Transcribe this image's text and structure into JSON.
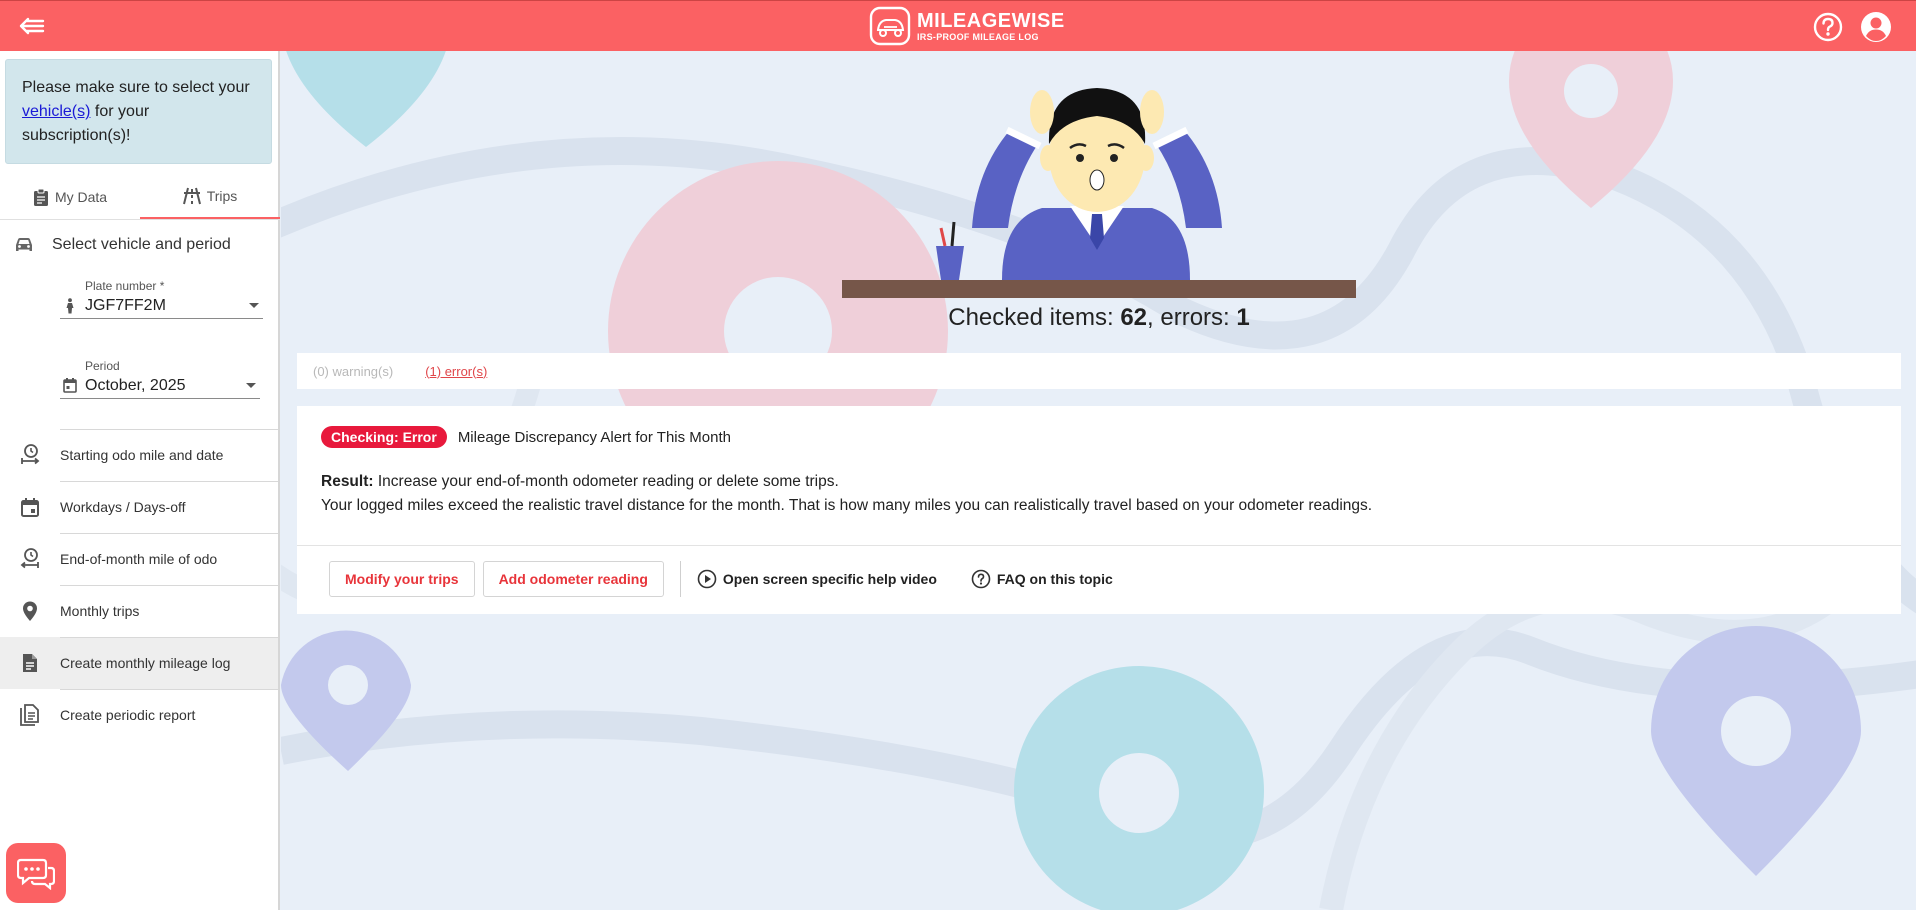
{
  "header": {
    "logo_title": "MILEAGEWISE",
    "logo_subtitle": "IRS-PROOF MILEAGE LOG",
    "back_icon": "arrow-back-icon",
    "help_icon": "help-icon",
    "account_icon": "account-icon",
    "accent_color": "#fb6163"
  },
  "sidebar": {
    "notice": {
      "prefix": "Please make sure to select your",
      "link": "vehicle(s)",
      "suffix": "for your subscription(s)!"
    },
    "tabs": [
      {
        "label": "My Data",
        "icon": "clipboard-icon",
        "active": false
      },
      {
        "label": "Trips",
        "icon": "road-icon",
        "active": true
      }
    ],
    "section_title": "Select vehicle and period",
    "plate": {
      "label": "Plate number *",
      "value": "JGF7FF2M"
    },
    "period": {
      "label": "Period",
      "value": "October, 2025"
    },
    "menu": [
      {
        "label": "Starting odo mile and date",
        "icon": "odometer-start-icon"
      },
      {
        "label": "Workdays / Days-off",
        "icon": "calendar-icon"
      },
      {
        "label": "End-of-month mile of odo",
        "icon": "odometer-end-icon"
      },
      {
        "label": "Monthly trips",
        "icon": "location-pin-icon"
      },
      {
        "label": "Create monthly mileage log",
        "icon": "document-icon",
        "active": true
      },
      {
        "label": "Create periodic report",
        "icon": "documents-icon"
      }
    ]
  },
  "main": {
    "checked": {
      "prefix": "Checked items: ",
      "items": "62",
      "mid": ", errors: ",
      "errors": "1"
    },
    "filters": {
      "warnings": "(0) warning(s)",
      "errors": "(1) error(s)"
    },
    "card": {
      "badge": "Checking: Error",
      "title": "Mileage Discrepancy Alert for This Month",
      "result_label": "Result:",
      "result_text": "Increase your end-of-month odometer reading or delete some trips.",
      "result_detail": "Your logged miles exceed the realistic travel distance for the month. That is how many miles you can realistically travel based on your odometer readings.",
      "buttons": {
        "modify": "Modify your trips",
        "add_odometer": "Add odometer reading",
        "help_video": "Open screen specific help video",
        "faq": "FAQ on this topic"
      }
    }
  }
}
